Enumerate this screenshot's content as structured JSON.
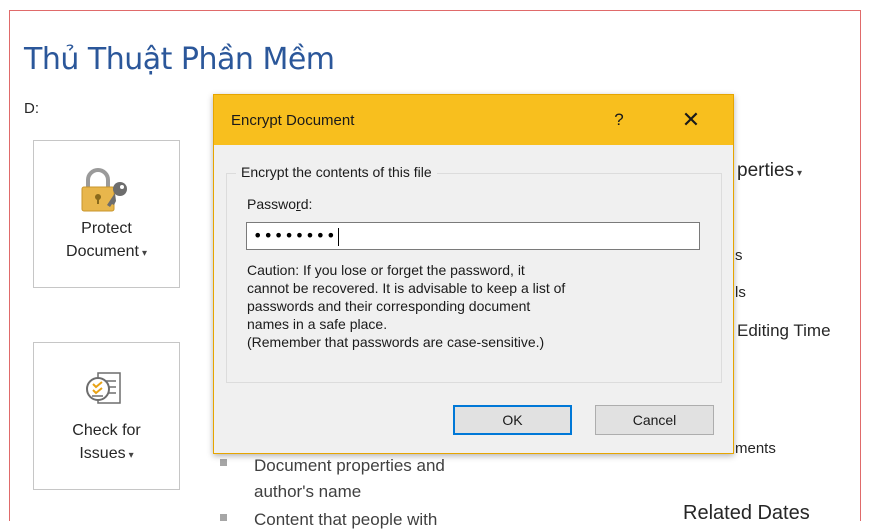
{
  "document": {
    "title": "Thủ Thuật Phần Mềm",
    "path": "D:"
  },
  "tiles": {
    "protect": {
      "line1": "Protect",
      "line2": "Document",
      "caret": "▾",
      "icon": "lock-key-icon"
    },
    "check": {
      "line1": "Check for",
      "line2": "Issues",
      "caret": "▾",
      "icon": "inspect-document-icon"
    }
  },
  "background": {
    "properties_header": "perties",
    "properties_caret": "▾",
    "prop_s": "s",
    "prop_ls": "ls",
    "editing_time": "Editing Time",
    "ments": "ments",
    "related_dates": "Related Dates",
    "bullet1_line1": "Document properties and",
    "bullet1_line2": "author's name",
    "bullet2_line1": "Content that people with"
  },
  "dialog": {
    "title": "Encrypt Document",
    "help_label": "?",
    "close_label": "✕",
    "group_label": "Encrypt the contents of this file",
    "password_label_pre": "Passwo",
    "password_label_accel": "r",
    "password_label_post": "d:",
    "password_value": "••••••••",
    "caution_lines": [
      "Caution: If you lose or forget the password, it",
      "cannot be recovered. It is advisable to keep a list of",
      "passwords and their corresponding document",
      "names in a safe place.",
      "(Remember that passwords are case-sensitive.)"
    ],
    "ok_label": "OK",
    "cancel_label": "Cancel"
  },
  "colors": {
    "titlebar": "#f8bf1e",
    "accent_title": "#2b579a",
    "focus": "#0078d7"
  }
}
